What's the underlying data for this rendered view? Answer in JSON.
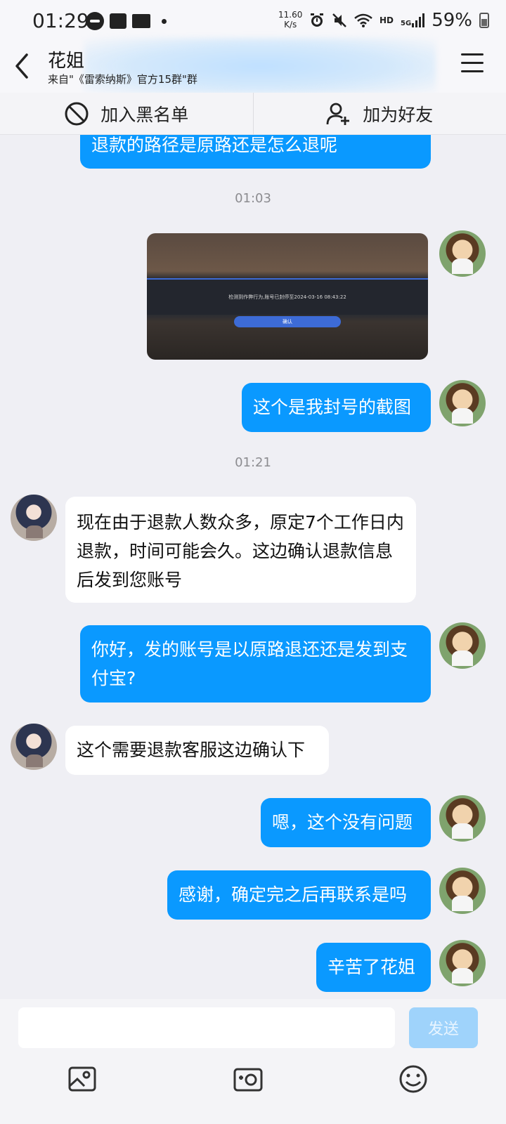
{
  "status_bar": {
    "time": "01:29",
    "net_speed_value": "11.60",
    "net_speed_unit": "K/s",
    "hd": "HD",
    "signal": "5G",
    "battery": "59%"
  },
  "header": {
    "title": "花姐",
    "subtitle": "来自\"《雷索纳斯》官方15群\"群"
  },
  "actions": {
    "blacklist_label": "加入黑名单",
    "add_friend_label": "加为好友"
  },
  "messages": [
    {
      "text": "退款的路径是原路还是怎么退呢",
      "from": "me"
    },
    {
      "time": "01:03"
    },
    {
      "image_text": "检测到作弊行为,账号已封停至2024-03-16 08:43:22",
      "image_button": "确认",
      "from": "me"
    },
    {
      "text": "这个是我封号的截图",
      "from": "me"
    },
    {
      "time": "01:21"
    },
    {
      "text": "现在由于退款人数众多，原定7个工作日内退款，时间可能会久。这边确认退款信息后发到您账号",
      "from": "her"
    },
    {
      "text": "你好，发的账号是以原路退还还是发到支付宝?",
      "from": "me"
    },
    {
      "text": "这个需要退款客服这边确认下",
      "from": "her"
    },
    {
      "text": "嗯，这个没有问题",
      "from": "me"
    },
    {
      "text": "感谢，确定完之后再联系是吗",
      "from": "me"
    },
    {
      "text": "辛苦了花姐",
      "from": "me"
    }
  ],
  "input": {
    "placeholder": "",
    "send_label": "发送"
  },
  "colors": {
    "outgoing_bubble": "#0a99ff",
    "incoming_bubble": "#ffffff",
    "background": "#efeff4",
    "send_disabled": "#9fd3fb"
  },
  "icons": [
    "back-arrow-icon",
    "menu-icon",
    "block-icon",
    "add-friend-icon",
    "photo-icon",
    "camera-icon",
    "emoji-icon"
  ]
}
